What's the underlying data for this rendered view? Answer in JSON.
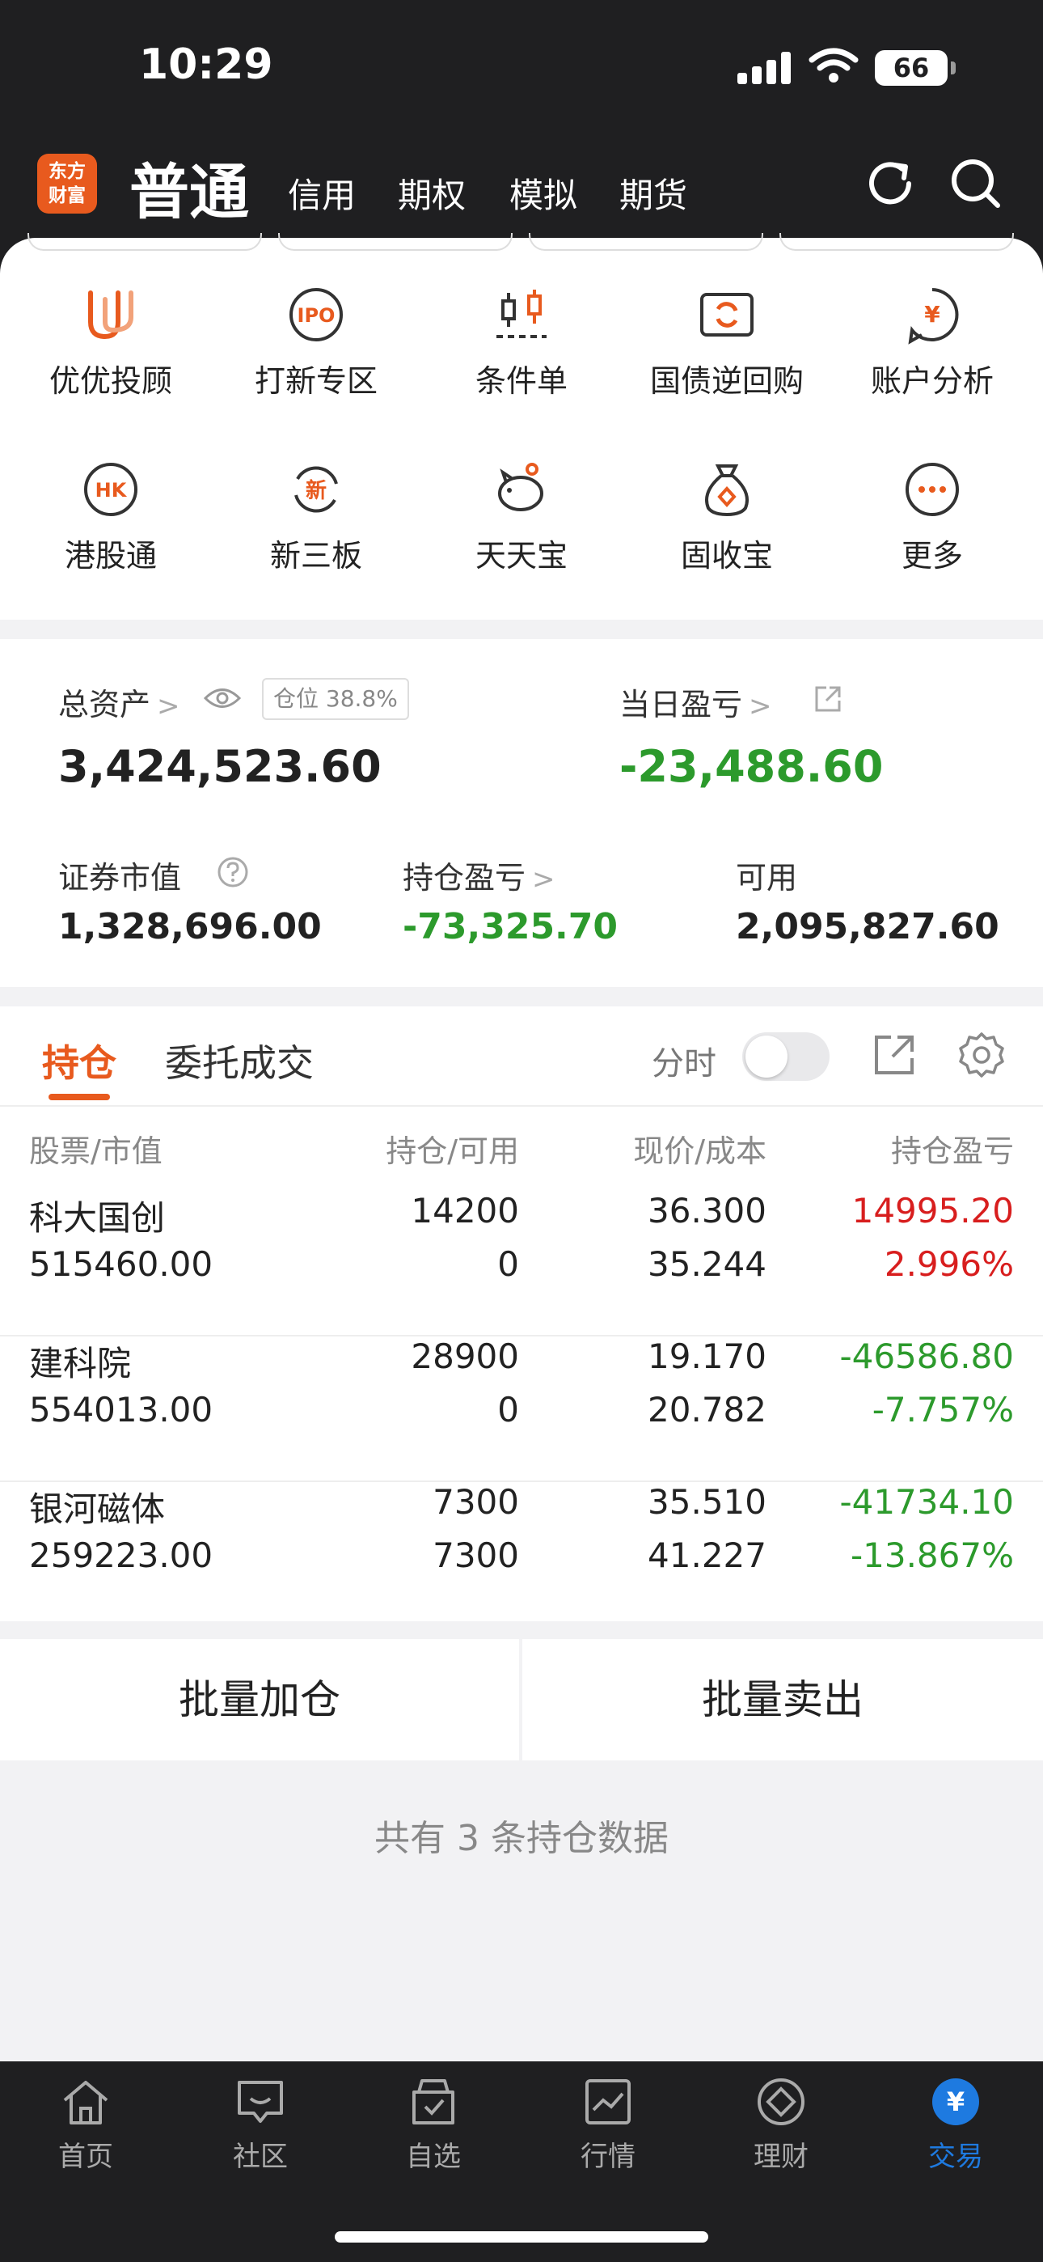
{
  "status": {
    "time": "10:29",
    "battery": "66"
  },
  "nav": {
    "logo_line1": "东方",
    "logo_line2": "财富",
    "title": "普通",
    "tabs": [
      "信用",
      "期权",
      "模拟",
      "期货"
    ]
  },
  "shortcuts": [
    {
      "label": "优优投顾",
      "icon": "uu-advisor-icon"
    },
    {
      "label": "打新专区",
      "icon": "ipo-icon"
    },
    {
      "label": "条件单",
      "icon": "condition-order-icon"
    },
    {
      "label": "国债逆回购",
      "icon": "repo-icon"
    },
    {
      "label": "账户分析",
      "icon": "account-analysis-icon"
    },
    {
      "label": "港股通",
      "icon": "hk-connect-icon"
    },
    {
      "label": "新三板",
      "icon": "new-otc-icon"
    },
    {
      "label": "天天宝",
      "icon": "piggy-bank-icon"
    },
    {
      "label": "固收宝",
      "icon": "money-bag-icon"
    },
    {
      "label": "更多",
      "icon": "more-icon"
    }
  ],
  "shortcut_icon_texts": {
    "ipo": "IPO",
    "hk": "HK",
    "xin": "新",
    "yen": "¥"
  },
  "assets": {
    "total_label": "总资产",
    "total_value": "3,424,523.60",
    "position_badge": "仓位 38.8%",
    "daily_pl_label": "当日盈亏",
    "daily_pl_value": "-23,488.60",
    "securities_label": "证券市值",
    "securities_value": "1,328,696.00",
    "hold_pl_label": "持仓盈亏",
    "hold_pl_value": "-73,325.70",
    "available_label": "可用",
    "available_value": "2,095,827.60"
  },
  "holdings": {
    "tab_active": "持仓",
    "tab_other": "委托成交",
    "fenshi_label": "分时",
    "columns": [
      "股票/市值",
      "持仓/可用",
      "现价/成本",
      "持仓盈亏"
    ],
    "rows": [
      {
        "name": "科大国创",
        "market_value": "515460.00",
        "qty": "14200",
        "avail": "0",
        "price": "36.300",
        "cost": "35.244",
        "pl": "14995.20",
        "pl_pct": "2.996%",
        "trend": "up"
      },
      {
        "name": "建科院",
        "market_value": "554013.00",
        "qty": "28900",
        "avail": "0",
        "price": "19.170",
        "cost": "20.782",
        "pl": "-46586.80",
        "pl_pct": "-7.757%",
        "trend": "down"
      },
      {
        "name": "银河磁体",
        "market_value": "259223.00",
        "qty": "7300",
        "avail": "7300",
        "price": "35.510",
        "cost": "41.227",
        "pl": "-41734.10",
        "pl_pct": "-13.867%",
        "trend": "down"
      }
    ]
  },
  "actions": {
    "batch_add": "批量加仓",
    "batch_sell": "批量卖出"
  },
  "summary": "共有 3 条持仓数据",
  "tabbar": [
    {
      "label": "首页",
      "icon": "home-icon"
    },
    {
      "label": "社区",
      "icon": "community-icon"
    },
    {
      "label": "自选",
      "icon": "watchlist-icon"
    },
    {
      "label": "行情",
      "icon": "market-icon"
    },
    {
      "label": "理财",
      "icon": "wealth-icon"
    },
    {
      "label": "交易",
      "icon": "trade-icon",
      "active": true
    }
  ],
  "tabbar_trade_glyph": "¥",
  "colors": {
    "accent": "#e85a1e",
    "up": "#d81e1e",
    "down": "#2c9a2c",
    "active_tab": "#1e7ae0"
  }
}
